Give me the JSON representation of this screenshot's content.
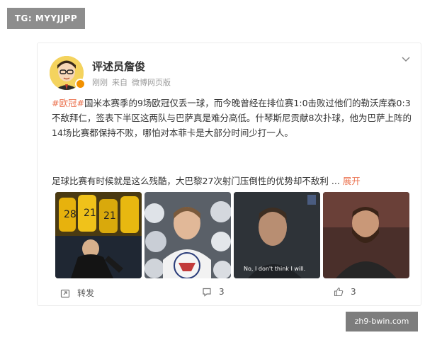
{
  "tg_badge": "TG: MYYJJPP",
  "post": {
    "author": "评述员詹俊",
    "time": "刚刚",
    "source_prefix": "来自",
    "source": "微博网页版",
    "hashtag": "#欧冠#",
    "body": "国米本赛季的9场欧冠仅丢一球，而今晚曾经在排位赛1:0击败过他们的勒沃库森0:3不敌拜仁，签表下半区这两队与巴萨真是难分高低。什琴斯尼贡献8次扑球，他为巴萨上阵的14场比赛都保持不败，哪怕对本菲卡是大部分时间少打一人。",
    "second_line": "足球比赛有时候就是这么残酷，大巴黎27次射门压倒性的优势却不敌利 ...",
    "expand": "展开",
    "images": [
      {
        "name": "team-celebration-photo",
        "caption": ""
      },
      {
        "name": "striker-portrait-photo",
        "caption": ""
      },
      {
        "name": "goalkeeper-meme-photo",
        "caption": "No, I don't think I will."
      },
      {
        "name": "goalkeeper-portrait-photo",
        "caption": ""
      }
    ]
  },
  "actions": {
    "repost_label": "转发",
    "comment_count": "3",
    "like_count": "3"
  },
  "watermark": "zh9-bwin.com",
  "icons": {
    "more": "chevron-down-icon",
    "repost": "repost-icon",
    "comment": "comment-icon",
    "like": "like-icon"
  },
  "colors": {
    "accent": "#eb7350",
    "badge": "#f29100"
  }
}
